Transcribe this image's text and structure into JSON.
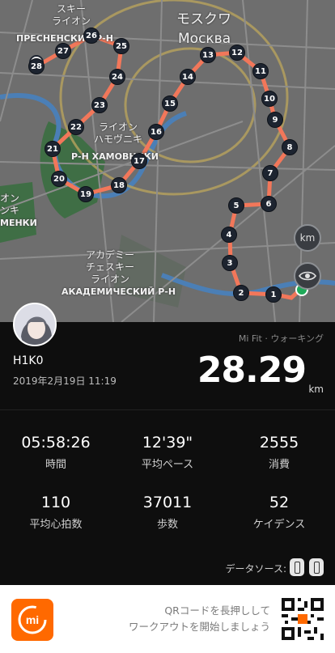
{
  "map": {
    "labels": {
      "moscow_ja": "モスクワ",
      "moscow_ru": "Москва",
      "presnensky_1": "スキー",
      "presnensky_2": "ライオン",
      "presnensky_ru": "ПРЕСНЕНСКИЙ Р-Н",
      "khamovniki_1": "ライオン",
      "khamovniki_2": "ハモヴニキ",
      "khamovniki_ru": "Р-Н ХАМОВНИКИ",
      "left_1": "オン",
      "left_2": "ンキ",
      "left_ru": "МЕНКИ",
      "akadem_1": "アカデミー",
      "akadem_2": "チェスキー",
      "akadem_3": "ライオン",
      "akadem_ru": "АКАДЕМИЧЕСКИЙ Р-Н"
    },
    "km_button": "km",
    "markers": [
      "1",
      "2",
      "3",
      "4",
      "5",
      "6",
      "7",
      "8",
      "9",
      "10",
      "11",
      "12",
      "13",
      "14",
      "15",
      "16",
      "17",
      "18",
      "19",
      "20",
      "21",
      "22",
      "23",
      "24",
      "25",
      "26",
      "27",
      "28"
    ]
  },
  "summary": {
    "username": "H1K0",
    "date": "2019年2月19日 11:19",
    "source": "Mi Fit · ウォーキング",
    "distance": "28.29",
    "unit": "km"
  },
  "stats": [
    {
      "value": "05:58:26",
      "label": "時間"
    },
    {
      "value": "12'39\"",
      "label": "平均ペース"
    },
    {
      "value": "2555",
      "label": "消費"
    },
    {
      "value": "110",
      "label": "平均心拍数"
    },
    {
      "value": "37011",
      "label": "歩数"
    },
    {
      "value": "52",
      "label": "ケイデンス"
    }
  ],
  "data_source_label": "データソース:",
  "footer": {
    "qr_line1": "QRコードを長押しして",
    "qr_line2": "ワークアウトを開始しましょう",
    "brand": "mi"
  },
  "colors": {
    "route": "#f2775a",
    "accent": "#ff6900",
    "finish": "#1faa59"
  }
}
